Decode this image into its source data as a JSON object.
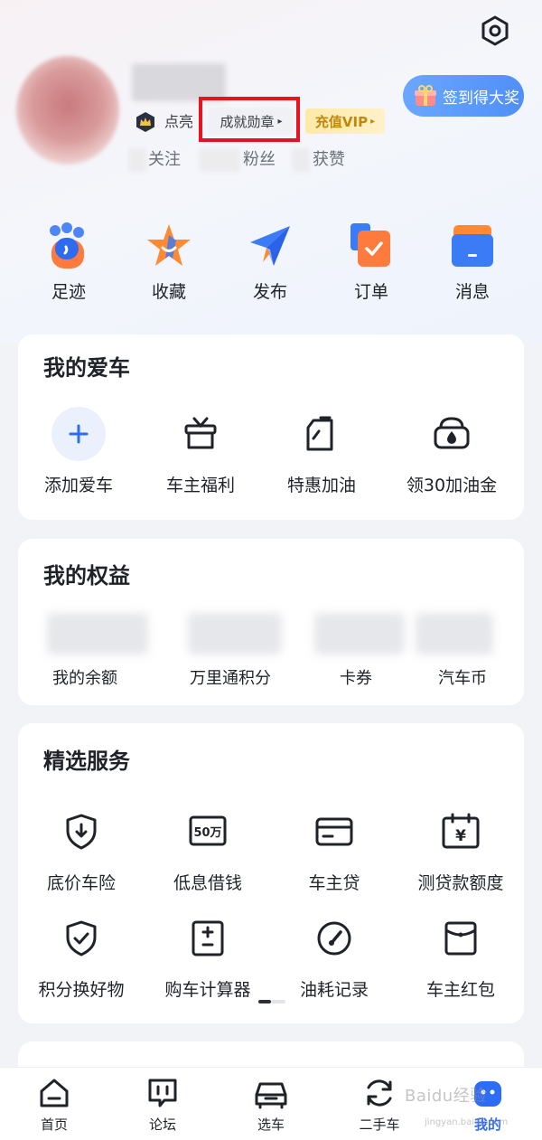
{
  "profile": {
    "light_label": "点亮",
    "badge_label": "成就勋章",
    "badge_arrow": "▸",
    "vip_label": "充值VIP",
    "vip_arrow": "▸",
    "follow_label": "关注",
    "fans_label": "粉丝",
    "likes_label": "获赞",
    "checkin_label": "签到得大奖"
  },
  "quick_actions": [
    {
      "label": "足迹",
      "icon": "footprint-icon"
    },
    {
      "label": "收藏",
      "icon": "star-icon"
    },
    {
      "label": "发布",
      "icon": "send-icon"
    },
    {
      "label": "订单",
      "icon": "order-icon"
    },
    {
      "label": "消息",
      "icon": "message-icon"
    }
  ],
  "my_car": {
    "title": "我的爱车",
    "items": [
      {
        "label": "添加爱车",
        "icon": "add-icon"
      },
      {
        "label": "车主福利",
        "icon": "gift-box-icon"
      },
      {
        "label": "特惠加油",
        "icon": "fuel-can-icon"
      },
      {
        "label": "领30加油金",
        "icon": "gas-pump-icon"
      }
    ]
  },
  "my_rights": {
    "title": "我的权益",
    "items": [
      {
        "label": "我的余额"
      },
      {
        "label": "万里通积分"
      },
      {
        "label": "卡券"
      },
      {
        "label": "汽车币"
      }
    ]
  },
  "services": {
    "title": "精选服务",
    "items": [
      {
        "label": "底价车险",
        "icon": "shield-download-icon"
      },
      {
        "label": "低息借钱",
        "icon": "loan-50w-icon",
        "icon_text": "50万"
      },
      {
        "label": "车主贷",
        "icon": "card-icon"
      },
      {
        "label": "测贷款额度",
        "icon": "calendar-yen-icon",
        "icon_text": "¥"
      },
      {
        "label": "积分换好物",
        "icon": "shield-check-icon"
      },
      {
        "label": "购车计算器",
        "icon": "calculator-icon"
      },
      {
        "label": "油耗记录",
        "icon": "gauge-icon"
      },
      {
        "label": "车主红包",
        "icon": "red-envelope-icon"
      }
    ]
  },
  "tabbar": [
    {
      "label": "首页",
      "icon": "home-icon"
    },
    {
      "label": "论坛",
      "icon": "forum-icon"
    },
    {
      "label": "选车",
      "icon": "car-icon"
    },
    {
      "label": "二手车",
      "icon": "refresh-icon"
    },
    {
      "label": "我的",
      "icon": "profile-icon",
      "active": true
    }
  ],
  "watermark": {
    "main": "Baidu经验",
    "sub": "jingyan.baidu.com"
  },
  "colors": {
    "accent": "#2d6cf6",
    "highlight": "#e5141e",
    "vip": "#c4860a",
    "background": "#f2f3f7"
  }
}
